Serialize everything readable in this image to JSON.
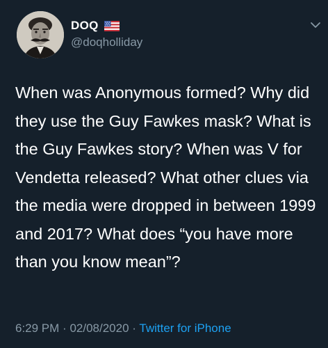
{
  "tweet": {
    "author": {
      "display_name": "DOQ",
      "flag_icon": "us-flag-icon",
      "handle": "@doqholliday",
      "avatar_icon": "mustached-man-portrait"
    },
    "text": "When was Anonymous formed? Why did they use the Guy Fawkes mask? What is the Guy Fawkes story? When was V for Vendetta released? What other clues via the media were dropped in between 1999 and 2017? What does “you have more than you know mean”?",
    "time": "6:29 PM",
    "separator": "·",
    "date": "02/08/2020",
    "source": "Twitter for iPhone",
    "menu_icon": "chevron-down-icon"
  },
  "colors": {
    "background": "#15202b",
    "text": "#ffffff",
    "secondary": "#8899a6",
    "link": "#1da1f2"
  }
}
